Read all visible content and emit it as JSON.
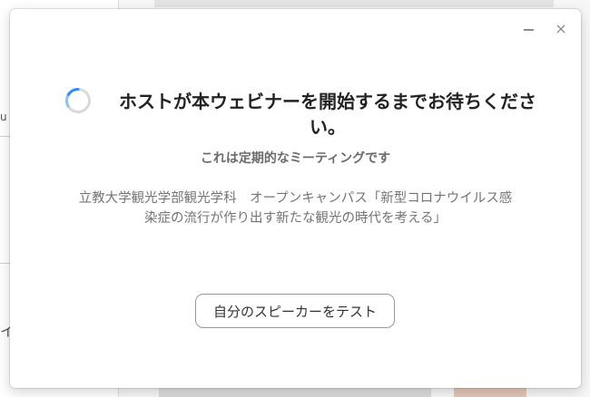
{
  "background": {
    "edge_chars": [
      "u",
      "イ"
    ]
  },
  "dialog": {
    "controls": {
      "minimize_icon": "minimize-icon",
      "close_symbol": "×"
    },
    "spinner_icon": "loading-spinner-icon",
    "heading": "ホストが本ウェビナーを開始するまでお待ちください。",
    "subheading": "これは定期的なミーティングです",
    "topic_lines": [
      "立教大学観光学部観光学科　オープンキャンパス「新型コロナウイルス感",
      "染症の流行が作り出す新たな観光の時代を考える」"
    ],
    "test_speaker_label": "自分のスピーカーをテスト"
  },
  "colors": {
    "spinner_accent": "#2d8cff",
    "spinner_track": "#d9d9d9",
    "heading_text": "#222222",
    "muted_text": "#747474"
  }
}
